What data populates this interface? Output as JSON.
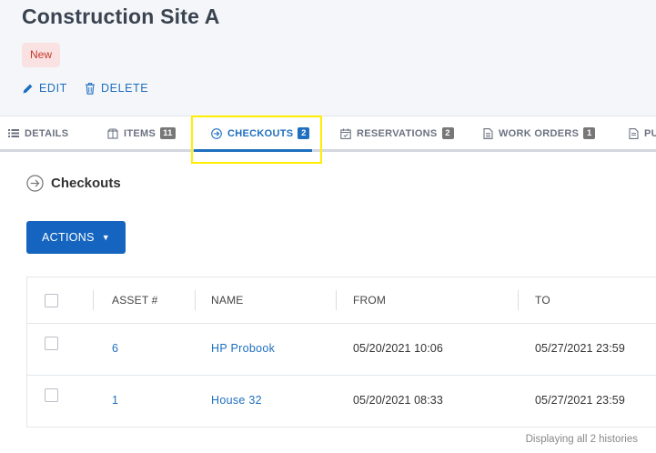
{
  "page": {
    "title": "Construction Site A",
    "status": "New"
  },
  "actions": {
    "edit": "EDIT",
    "delete": "DELETE"
  },
  "tabs": [
    {
      "label": "DETAILS",
      "icon": "list-icon"
    },
    {
      "label": "ITEMS",
      "count": "11",
      "icon": "box-icon"
    },
    {
      "label": "CHECKOUTS",
      "count": "2",
      "icon": "arrow-circle-icon",
      "active": true
    },
    {
      "label": "RESERVATIONS",
      "count": "2",
      "icon": "calendar-icon"
    },
    {
      "label": "WORK ORDERS",
      "count": "1",
      "icon": "document-icon"
    },
    {
      "label": "PU",
      "icon": "document-icon"
    }
  ],
  "section": {
    "title": "Checkouts"
  },
  "actions_button": {
    "label": "ACTIONS"
  },
  "table": {
    "headers": [
      "ASSET #",
      "NAME",
      "FROM",
      "TO"
    ],
    "rows": [
      {
        "asset": "6",
        "name": "HP Probook",
        "from": "05/20/2021 10:06",
        "to": "05/27/2021 23:59"
      },
      {
        "asset": "1",
        "name": "House 32",
        "from": "05/20/2021 08:33",
        "to": "05/27/2021 23:59"
      }
    ]
  },
  "footer": {
    "summary": "Displaying all 2 histories"
  },
  "colors": {
    "accent": "#1e6fbf",
    "button": "#1565c0",
    "badge_bg": "#fbe2e2",
    "badge_text": "#c0392b",
    "highlight": "#ffee00"
  }
}
